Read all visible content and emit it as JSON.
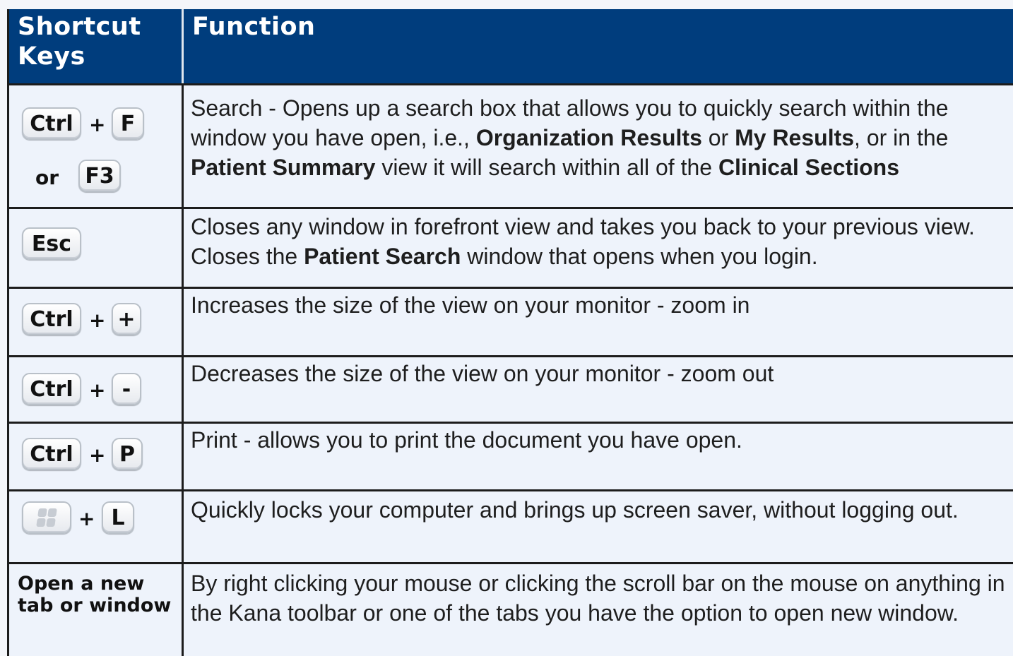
{
  "header": {
    "keys_label": "Shortcut Keys",
    "function_label": "Function"
  },
  "rows": [
    {
      "keys": [
        "Ctrl",
        "F"
      ],
      "alt_word": "or",
      "alt_key": "F3",
      "segments": [
        "Search - Opens up a search box that allows you to quickly search within the window you have open, i.e., ",
        "Organization Results",
        " or ",
        "My Results",
        ", or in the ",
        "Patient Summary",
        " view it will search within all of the ",
        "Clinical Sections"
      ]
    },
    {
      "keys": [
        "Esc"
      ],
      "segments": [
        "Closes any window in forefront view and takes you back to your previous view. Closes the ",
        "Patient Search",
        " window that opens when you login."
      ]
    },
    {
      "keys": [
        "Ctrl",
        "+"
      ],
      "segments": [
        "Increases the size of the view on your monitor - zoom in"
      ]
    },
    {
      "keys": [
        "Ctrl",
        "-"
      ],
      "segments": [
        "Decreases the size of the view on your monitor - zoom out"
      ]
    },
    {
      "keys": [
        "Ctrl",
        "P"
      ],
      "segments": [
        "Print - allows you to print the document you have open."
      ]
    },
    {
      "keys": [
        "windows-logo-icon",
        "L"
      ],
      "segments": [
        "Quickly locks your computer and brings up screen saver, without logging out."
      ]
    },
    {
      "keys_label": "Open a new tab or window",
      "segments": [
        "By right clicking your mouse or clicking the scroll bar on the mouse on anything in the Kana toolbar or one of the tabs you have the option to open new window."
      ]
    }
  ],
  "plus_sign": "+",
  "colors": {
    "header_bg": "#003d7d",
    "header_text": "#ffffff",
    "row_bg": "#eef3fb",
    "border": "#1c1c1c"
  }
}
